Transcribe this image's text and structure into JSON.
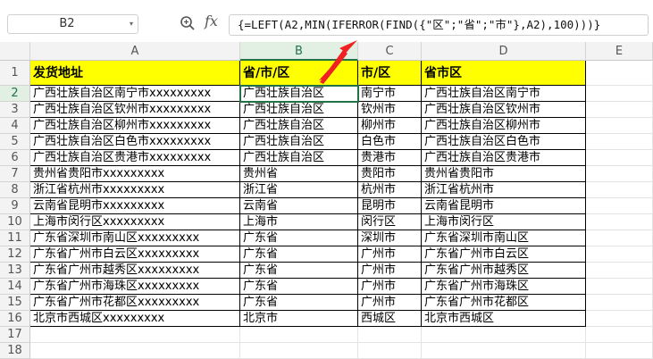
{
  "formula_bar": {
    "name_box": "B2",
    "fx_label": "fx",
    "formula": "{=LEFT(A2,MIN(IFERROR(FIND({\"区\";\"省\";\"市\"},A2),100)))}"
  },
  "columns": [
    "A",
    "B",
    "C",
    "D",
    "E"
  ],
  "rows": [
    "1",
    "2",
    "3",
    "4",
    "5",
    "6",
    "7",
    "8",
    "9",
    "10",
    "11",
    "12",
    "13",
    "14",
    "15",
    "16",
    "17",
    "18"
  ],
  "headers": [
    "发货地址",
    "省/市/区",
    "市/区",
    "省市区"
  ],
  "table": [
    [
      "广西壮族自治区南宁市xxxxxxxxx",
      "广西壮族自治区",
      "南宁市",
      "广西壮族自治区南宁市"
    ],
    [
      "广西壮族自治区钦州市xxxxxxxxx",
      "广西壮族自治区",
      "钦州市",
      "广西壮族自治区钦州市"
    ],
    [
      "广西壮族自治区柳州市xxxxxxxxx",
      "广西壮族自治区",
      "柳州市",
      "广西壮族自治区柳州市"
    ],
    [
      "广西壮族自治区白色市xxxxxxxxx",
      "广西壮族自治区",
      "白色市",
      "广西壮族自治区白色市"
    ],
    [
      "广西壮族自治区贵港市xxxxxxxxx",
      "广西壮族自治区",
      "贵港市",
      "广西壮族自治区贵港市"
    ],
    [
      "贵州省贵阳市xxxxxxxxx",
      "贵州省",
      "贵阳市",
      "贵州省贵阳市"
    ],
    [
      "浙江省杭州市xxxxxxxxx",
      "浙江省",
      "杭州市",
      "浙江省杭州市"
    ],
    [
      "云南省昆明市xxxxxxxxx",
      "云南省",
      "昆明市",
      "云南省昆明市"
    ],
    [
      "上海市闵行区xxxxxxxxx",
      "上海市",
      "闵行区",
      "上海市闵行区"
    ],
    [
      "广东省深圳市南山区xxxxxxxxx",
      "广东省",
      "深圳市",
      "广东省深圳市南山区"
    ],
    [
      "广东省广州市白云区xxxxxxxxx",
      "广东省",
      "广州市",
      "广东省广州市白云区"
    ],
    [
      "广东省广州市越秀区xxxxxxxxx",
      "广东省",
      "广州市",
      "广东省广州市越秀区"
    ],
    [
      "广东省广州市海珠区xxxxxxxxx",
      "广东省",
      "广州市",
      "广东省广州市海珠区"
    ],
    [
      "广东省广州市花都区xxxxxxxxx",
      "广东省",
      "广州市",
      "广东省广州市花都区"
    ],
    [
      "北京市西城区xxxxxxxxx",
      "北京市",
      "西城区",
      "北京市西城区"
    ]
  ],
  "selected": {
    "column": "B",
    "row": "2"
  },
  "colors": {
    "header_fill": "#ffff00",
    "selection": "#217346",
    "arrow": "#ee2222"
  }
}
